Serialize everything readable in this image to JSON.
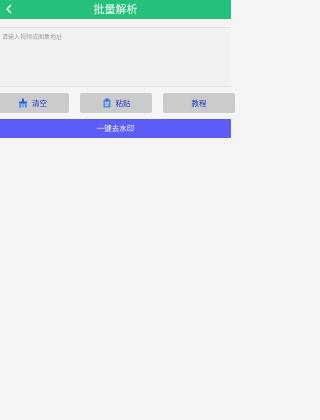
{
  "header": {
    "title": "批量解析",
    "back_icon": "chevron-left-icon",
    "background": "#25c17b"
  },
  "input": {
    "placeholder": "请输入视频或图集地址",
    "value": ""
  },
  "buttons": {
    "clear_label": "清空",
    "clear_icon": "broom-icon",
    "paste_label": "粘贴",
    "paste_icon": "clipboard-icon",
    "tutorial_label": "教程",
    "label_color": "#1a37c9",
    "background": "#cbcbcb"
  },
  "primary": {
    "label": "一键去水印",
    "background": "#5c5cf6"
  }
}
